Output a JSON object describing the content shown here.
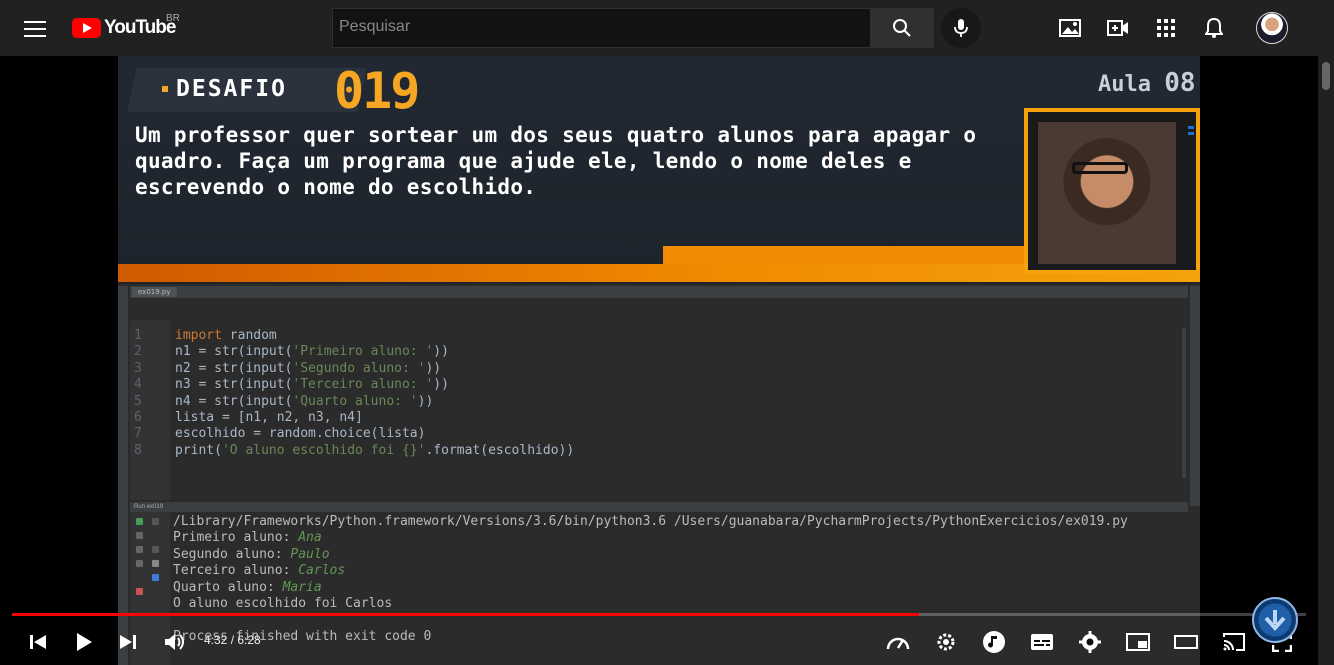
{
  "header": {
    "logo_text": "YouTube",
    "country_code": "BR",
    "search_placeholder": "Pesquisar"
  },
  "icons": {
    "menu": "hamburger-icon",
    "search": "search-icon",
    "mic": "mic-icon",
    "gallery": "image-icon",
    "create": "video-camera-plus-icon",
    "apps": "apps-grid-icon",
    "notifications": "bell-icon"
  },
  "video_frame": {
    "desafio_label": "DESAFIO",
    "desafio_number": "019",
    "aula_label": "Aula",
    "aula_number": "08",
    "challenge_text": "Um professor quer sortear um dos seus quatro alunos para apagar o quadro. Faça um programa que ajude ele, lendo o nome deles e escrevendo o nome do escolhido.",
    "ide": {
      "tab_name": "ex019.py",
      "run_label": "Run",
      "run_tab": "ex019",
      "code_lines": [
        {
          "n": "1",
          "parts": [
            {
              "t": "import",
              "c": "kw"
            },
            {
              "t": " random",
              "c": ""
            }
          ]
        },
        {
          "n": "2",
          "parts": [
            {
              "t": "n1 = str(input(",
              "c": ""
            },
            {
              "t": "'Primeiro aluno: '",
              "c": "str"
            },
            {
              "t": "))",
              "c": ""
            }
          ]
        },
        {
          "n": "3",
          "parts": [
            {
              "t": "n2 = str(input(",
              "c": ""
            },
            {
              "t": "'Segundo aluno: '",
              "c": "str"
            },
            {
              "t": "))",
              "c": ""
            }
          ]
        },
        {
          "n": "4",
          "parts": [
            {
              "t": "n3 = str(input(",
              "c": ""
            },
            {
              "t": "'Terceiro aluno: '",
              "c": "str"
            },
            {
              "t": "))",
              "c": ""
            }
          ]
        },
        {
          "n": "5",
          "parts": [
            {
              "t": "n4 = str(input(",
              "c": ""
            },
            {
              "t": "'Quarto aluno: '",
              "c": "str"
            },
            {
              "t": "))",
              "c": ""
            }
          ]
        },
        {
          "n": "6",
          "parts": [
            {
              "t": "lista = [n1, n2, n3, n4]",
              "c": ""
            }
          ]
        },
        {
          "n": "7",
          "parts": [
            {
              "t": "escolhido = random.choice(lista)",
              "c": ""
            }
          ]
        },
        {
          "n": "8",
          "parts": [
            {
              "t": "print(",
              "c": ""
            },
            {
              "t": "'O aluno escolhido foi {}'",
              "c": "str"
            },
            {
              "t": ".format(escolhido))",
              "c": ""
            }
          ]
        }
      ],
      "console_lines": [
        {
          "prompt": "/Library/Frameworks/Python.framework/Versions/3.6/bin/python3.6 /Users/guanabara/PycharmProjects/PythonExercicios/ex019.py",
          "input": ""
        },
        {
          "prompt": "Primeiro aluno: ",
          "input": "Ana"
        },
        {
          "prompt": "Segundo aluno: ",
          "input": "Paulo"
        },
        {
          "prompt": "Terceiro aluno: ",
          "input": "Carlos"
        },
        {
          "prompt": "Quarto aluno: ",
          "input": "Maria"
        },
        {
          "prompt": "O aluno escolhido foi Carlos",
          "input": ""
        },
        {
          "prompt": "",
          "input": ""
        },
        {
          "prompt": "Process finished with exit code 0",
          "input": ""
        }
      ]
    }
  },
  "player": {
    "time_display": "4:32 / 6:28",
    "progress_fraction": 0.701,
    "accent": "#ff0000",
    "control_icons": [
      "previous-icon",
      "play-icon",
      "next-icon",
      "volume-icon"
    ],
    "right_icons": [
      "speed-icon",
      "settings-gear-icon",
      "music-note-icon",
      "subtitles-icon",
      "gear-icon",
      "miniplayer-icon",
      "theater-mode-icon",
      "cast-icon",
      "fullscreen-icon"
    ]
  }
}
